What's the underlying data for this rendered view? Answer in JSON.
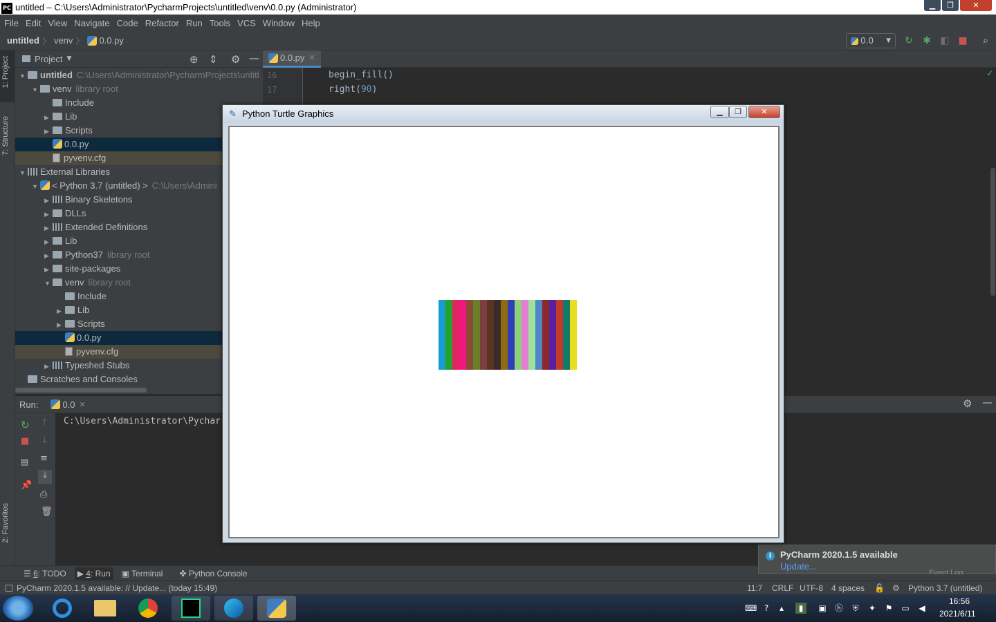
{
  "window": {
    "title": "untitled – C:\\Users\\Administrator\\PycharmProjects\\untitled\\venv\\0.0.py (Administrator)",
    "logo_text": "PC"
  },
  "menu": [
    "File",
    "Edit",
    "View",
    "Navigate",
    "Code",
    "Refactor",
    "Run",
    "Tools",
    "VCS",
    "Window",
    "Help"
  ],
  "breadcrumb": [
    "untitled",
    "venv",
    "0.0.py"
  ],
  "run_config": "0.0",
  "left_tabs": {
    "project": "1: Project",
    "structure": "7: Structure",
    "favorites": "2: Favorites"
  },
  "project_panel": {
    "title": "Project",
    "tree": [
      {
        "label": "untitled",
        "hint": "C:\\Users\\Administrator\\PycharmProjects\\untitl",
        "icon": "folder",
        "level": 0,
        "open": true
      },
      {
        "label": "venv",
        "hint": "library root",
        "icon": "folder",
        "level": 1,
        "open": true
      },
      {
        "label": "Include",
        "hint": "",
        "icon": "folder",
        "level": 2,
        "open": null
      },
      {
        "label": "Lib",
        "hint": "",
        "icon": "folder",
        "level": 2,
        "open": false
      },
      {
        "label": "Scripts",
        "hint": "",
        "icon": "folder",
        "level": 2,
        "open": false
      },
      {
        "label": "0.0.py",
        "hint": "",
        "icon": "python",
        "level": 2,
        "open": null,
        "state": "selected"
      },
      {
        "label": "pyvenv.cfg",
        "hint": "",
        "icon": "config",
        "level": 2,
        "open": null,
        "state": "highlight"
      },
      {
        "label": "External Libraries",
        "hint": "",
        "icon": "library",
        "level": 0,
        "open": true
      },
      {
        "label": "< Python 3.7 (untitled) >",
        "hint": "C:\\Users\\Admini",
        "icon": "python",
        "level": 1,
        "open": true
      },
      {
        "label": "Binary Skeletons",
        "hint": "",
        "icon": "library",
        "level": 2,
        "open": false
      },
      {
        "label": "DLLs",
        "hint": "",
        "icon": "folder",
        "level": 2,
        "open": false
      },
      {
        "label": "Extended Definitions",
        "hint": "",
        "icon": "library",
        "level": 2,
        "open": false
      },
      {
        "label": "Lib",
        "hint": "",
        "icon": "folder",
        "level": 2,
        "open": false
      },
      {
        "label": "Python37",
        "hint": "library root",
        "icon": "folder",
        "level": 2,
        "open": false
      },
      {
        "label": "site-packages",
        "hint": "",
        "icon": "folder",
        "level": 2,
        "open": false
      },
      {
        "label": "venv",
        "hint": "library root",
        "icon": "folder",
        "level": 2,
        "open": true
      },
      {
        "label": "Include",
        "hint": "",
        "icon": "folder",
        "level": 3,
        "open": null
      },
      {
        "label": "Lib",
        "hint": "",
        "icon": "folder",
        "level": 3,
        "open": false
      },
      {
        "label": "Scripts",
        "hint": "",
        "icon": "folder",
        "level": 3,
        "open": false
      },
      {
        "label": "0.0.py",
        "hint": "",
        "icon": "python",
        "level": 3,
        "open": null,
        "state": "selected"
      },
      {
        "label": "pyvenv.cfg",
        "hint": "",
        "icon": "config",
        "level": 3,
        "open": null,
        "state": "highlight"
      },
      {
        "label": "Typeshed Stubs",
        "hint": "",
        "icon": "library",
        "level": 2,
        "open": false
      },
      {
        "label": "Scratches and Consoles",
        "hint": "",
        "icon": "scratch",
        "level": 0,
        "open": null
      }
    ]
  },
  "editor": {
    "tab": "0.0.py",
    "lines": [
      {
        "num": "16",
        "name": "begin_fill",
        "arg": ""
      },
      {
        "num": "17",
        "name": "right",
        "arg": "90"
      }
    ]
  },
  "run_panel": {
    "label": "Run:",
    "tab": "0.0",
    "output": "C:\\Users\\Administrator\\Pychar"
  },
  "bottom_tools": [
    {
      "key": "6",
      "label": ": TODO"
    },
    {
      "key": "4",
      "label": ": Run"
    },
    {
      "key": "",
      "label": "Terminal"
    },
    {
      "key": "",
      "label": "Python Console"
    }
  ],
  "status": {
    "message": "PyCharm 2020.1.5 available: // Update... (today 15:49)",
    "position": "11:7",
    "line_sep": "CRLF",
    "encoding": "UTF-8",
    "indent": "4 spaces",
    "interpreter": "Python 3.7 (untitled)"
  },
  "notification": {
    "title": "PyCharm 2020.1.5 available",
    "link": "Update...",
    "event_log": "Event Log"
  },
  "turtle": {
    "title": "Python Turtle Graphics",
    "stripe_colors": [
      "#1a9bd1",
      "#22a12f",
      "#e0245e",
      "#f0187f",
      "#8b4a35",
      "#6b7f2a",
      "#7a3f3f",
      "#5a3420",
      "#3a2a2a",
      "#8f6a10",
      "#2f3fb8",
      "#8fd07a",
      "#e37fd5",
      "#9fe09a",
      "#4f87c4",
      "#8a2a2a",
      "#5a1fa0",
      "#c43a2a",
      "#117a6a",
      "#e6e020"
    ]
  },
  "taskbar": {
    "time": "16:56",
    "date": "2021/6/11"
  }
}
